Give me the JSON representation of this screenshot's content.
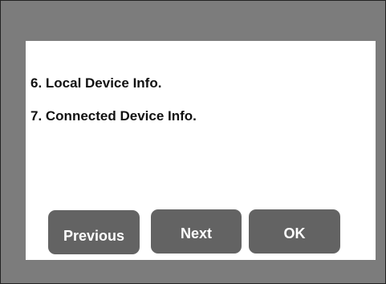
{
  "menu": {
    "items": [
      {
        "label": "6. Local Device Info."
      },
      {
        "label": "7. Connected Device Info."
      }
    ]
  },
  "buttons": {
    "previous_label": "Previous",
    "next_label": "Next",
    "ok_label": "OK"
  },
  "colors": {
    "frame": "#7c7c7c",
    "panel": "#ffffff",
    "button": "#636363",
    "button_text": "#ffffff",
    "text": "#111111"
  }
}
